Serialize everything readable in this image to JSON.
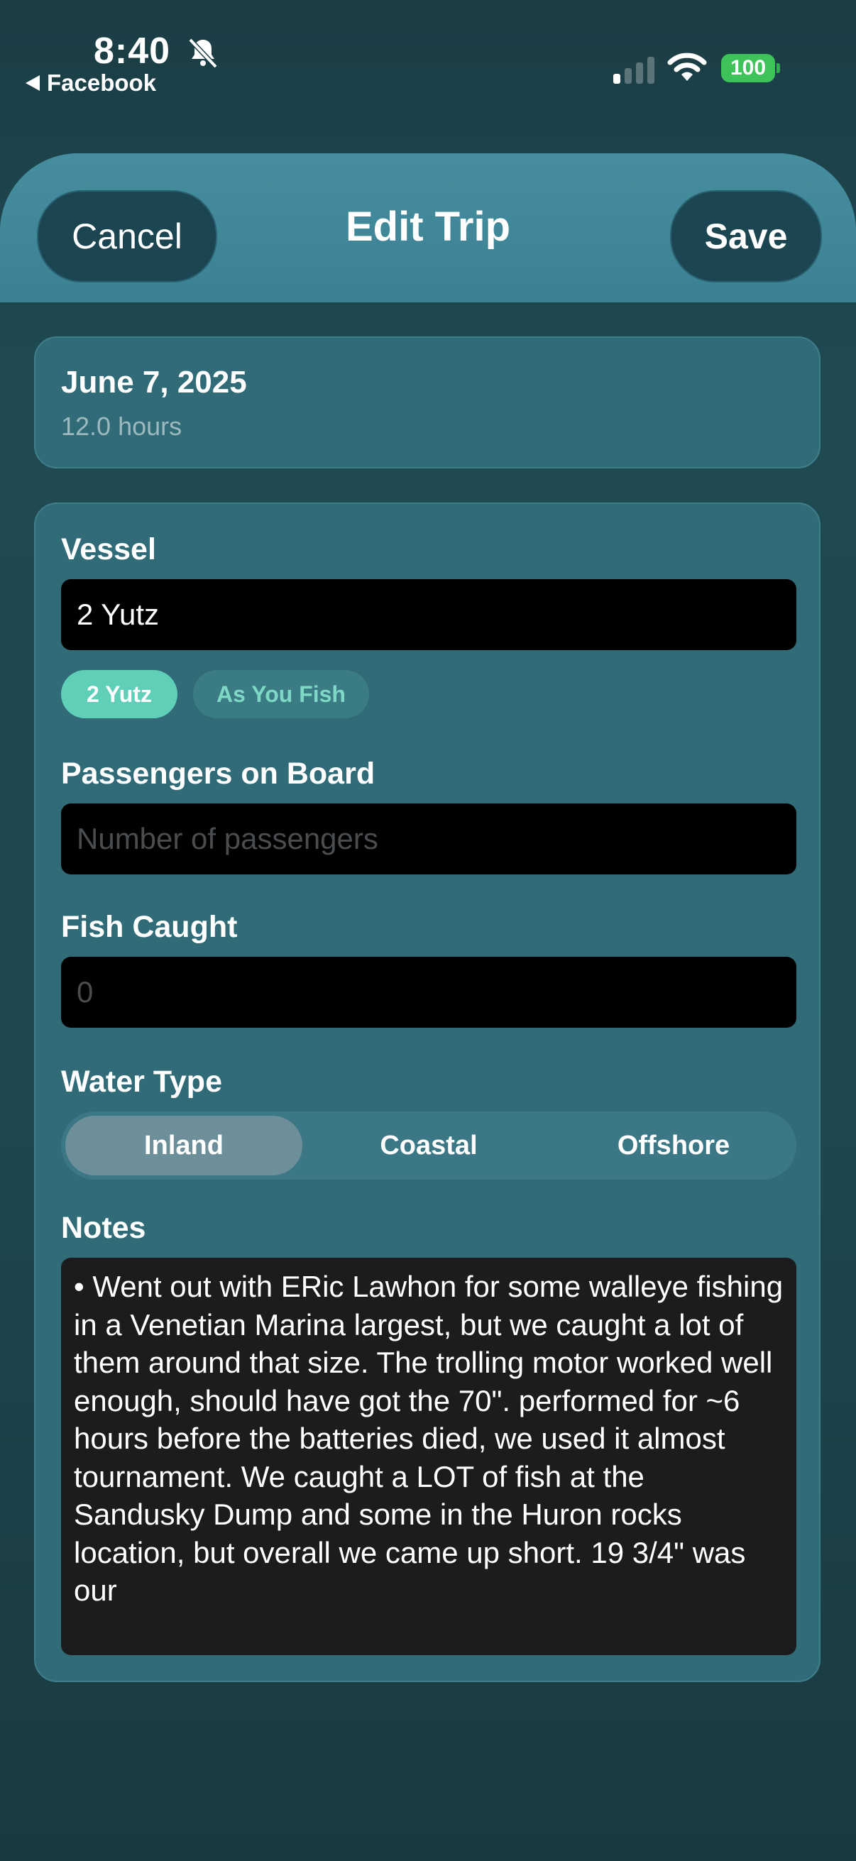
{
  "status_bar": {
    "time": "8:40",
    "back_app": "Facebook",
    "battery": "100",
    "icons": [
      "bell-slash-icon",
      "signal-icon",
      "wifi-icon",
      "battery-icon"
    ]
  },
  "header": {
    "title": "Edit Trip",
    "cancel_label": "Cancel",
    "save_label": "Save"
  },
  "trip": {
    "date": "June 7, 2025",
    "duration": "12.0 hours"
  },
  "form": {
    "vessel": {
      "label": "Vessel",
      "value": "2 Yutz",
      "suggestions": [
        {
          "label": "2 Yutz",
          "selected": true
        },
        {
          "label": "As You Fish",
          "selected": false
        }
      ]
    },
    "passengers": {
      "label": "Passengers on Board",
      "placeholder": "Number of passengers"
    },
    "fish_caught": {
      "label": "Fish Caught",
      "placeholder": "0"
    },
    "water_type": {
      "label": "Water Type",
      "options": [
        "Inland",
        "Coastal",
        "Offshore"
      ],
      "selected": "Inland"
    },
    "notes": {
      "label": "Notes",
      "value": "• Went out with ERic Lawhon for some walleye fishing in a Venetian Marina largest, but we caught a lot of them around that size. The trolling motor worked well enough, should have got the 70\". performed for ~6 hours before the batteries died, we used it almost tournament. We caught a LOT of fish at the Sandusky Dump and some in the Huron rocks location, but overall we came up short. 19 3/4\" was our"
    }
  },
  "colors": {
    "background": "#1e474f",
    "header": "#428a9b",
    "card": "#316b77",
    "accent_chip": "#5fcfb8",
    "battery": "#3ec25a"
  }
}
